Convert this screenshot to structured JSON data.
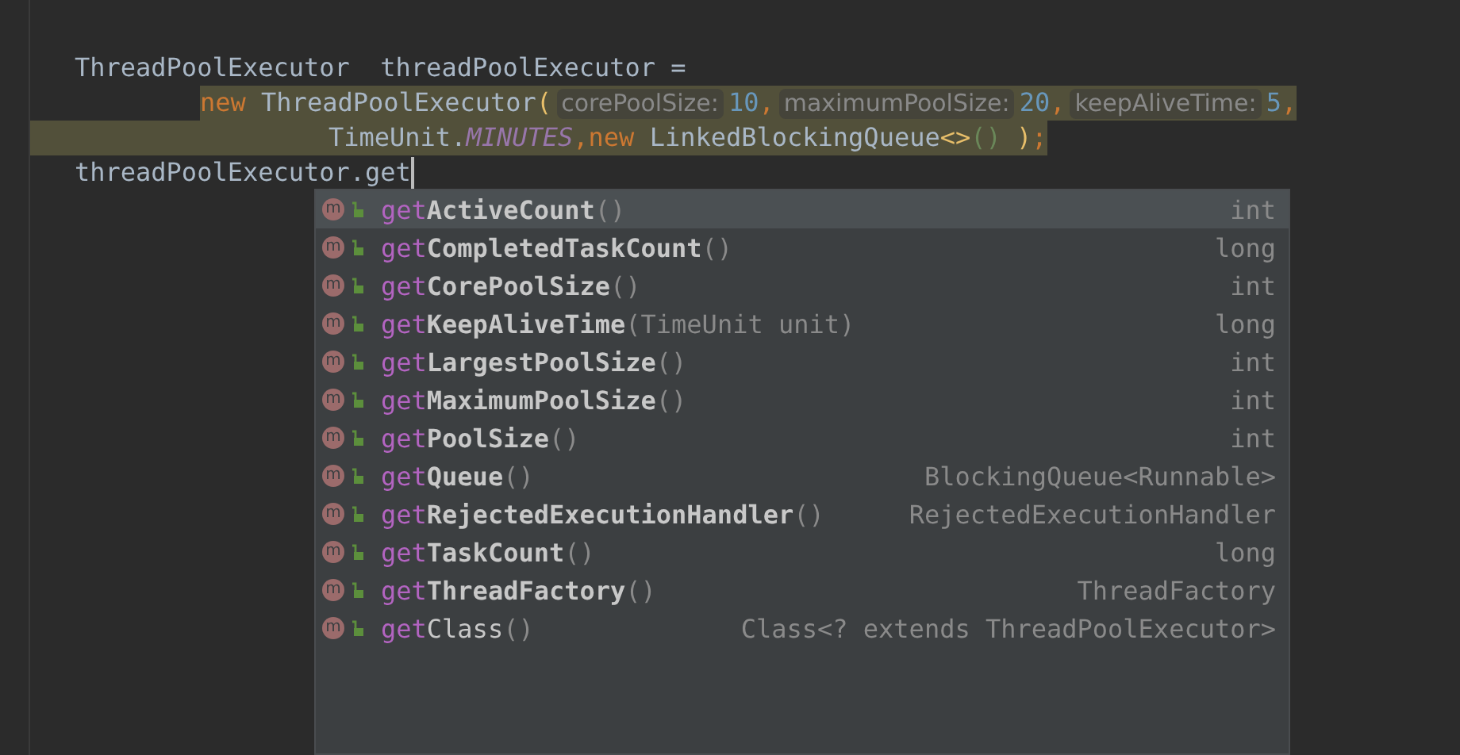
{
  "editor": {
    "lines": [
      {
        "kind": "top",
        "highlighted": false,
        "tokens": [
          {
            "kind": "ident",
            "text": "ThreadPoolExecutor  threadPoolExecutor ="
          }
        ]
      },
      {
        "kind": "indent1",
        "highlighted": true,
        "tokens": [
          {
            "kind": "keyword",
            "text": "new"
          },
          {
            "kind": "ident",
            "text": " ThreadPoolExecutor"
          },
          {
            "kind": "paren",
            "text": "("
          },
          {
            "kind": "hint",
            "text": "corePoolSize:"
          },
          {
            "kind": "number",
            "text": "10"
          },
          {
            "kind": "punct",
            "text": ","
          },
          {
            "kind": "hint",
            "text": "maximumPoolSize:"
          },
          {
            "kind": "number",
            "text": "20"
          },
          {
            "kind": "punct",
            "text": ","
          },
          {
            "kind": "hint",
            "text": "keepAliveTime:"
          },
          {
            "kind": "number",
            "text": "5"
          },
          {
            "kind": "punct",
            "text": ","
          }
        ]
      },
      {
        "kind": "indent2",
        "highlighted": true,
        "tokens": [
          {
            "kind": "ident",
            "text": "TimeUnit."
          },
          {
            "kind": "constant",
            "text": "MINUTES"
          },
          {
            "kind": "punct",
            "text": ","
          },
          {
            "kind": "keyword",
            "text": "new"
          },
          {
            "kind": "ident",
            "text": " LinkedBlockingQueue"
          },
          {
            "kind": "angle",
            "text": "<>"
          },
          {
            "kind": "bracket",
            "text": "()"
          },
          {
            "kind": "paren",
            "text": " )"
          },
          {
            "kind": "punct",
            "text": ";"
          }
        ]
      },
      {
        "kind": "top",
        "highlighted": false,
        "tokens": [
          {
            "kind": "ident",
            "text": "threadPoolExecutor.get"
          },
          {
            "kind": "caret"
          }
        ]
      }
    ]
  },
  "completion": {
    "items": [
      {
        "badge": "m",
        "prefix": "get",
        "name": "ActiveCount",
        "params": "()",
        "type": "int",
        "selected": true,
        "bold": true
      },
      {
        "badge": "m",
        "prefix": "get",
        "name": "CompletedTaskCount",
        "params": "()",
        "type": "long",
        "selected": false,
        "bold": true
      },
      {
        "badge": "m",
        "prefix": "get",
        "name": "CorePoolSize",
        "params": "()",
        "type": "int",
        "selected": false,
        "bold": true
      },
      {
        "badge": "m",
        "prefix": "get",
        "name": "KeepAliveTime",
        "params": "(TimeUnit unit)",
        "type": "long",
        "selected": false,
        "bold": true
      },
      {
        "badge": "m",
        "prefix": "get",
        "name": "LargestPoolSize",
        "params": "()",
        "type": "int",
        "selected": false,
        "bold": true
      },
      {
        "badge": "m",
        "prefix": "get",
        "name": "MaximumPoolSize",
        "params": "()",
        "type": "int",
        "selected": false,
        "bold": true
      },
      {
        "badge": "m",
        "prefix": "get",
        "name": "PoolSize",
        "params": "()",
        "type": "int",
        "selected": false,
        "bold": true
      },
      {
        "badge": "m",
        "prefix": "get",
        "name": "Queue",
        "params": "()",
        "type": "BlockingQueue<Runnable>",
        "selected": false,
        "bold": true
      },
      {
        "badge": "m",
        "prefix": "get",
        "name": "RejectedExecutionHandler",
        "params": "()",
        "type": "RejectedExecutionHandler",
        "selected": false,
        "bold": true
      },
      {
        "badge": "m",
        "prefix": "get",
        "name": "TaskCount",
        "params": "()",
        "type": "long",
        "selected": false,
        "bold": true
      },
      {
        "badge": "m",
        "prefix": "get",
        "name": "ThreadFactory",
        "params": "()",
        "type": "ThreadFactory",
        "selected": false,
        "bold": true
      },
      {
        "badge": "m",
        "prefix": "get",
        "name": "Class",
        "params": "()",
        "type": "Class<? extends ThreadPoolExecutor>",
        "selected": false,
        "bold": false
      }
    ]
  }
}
